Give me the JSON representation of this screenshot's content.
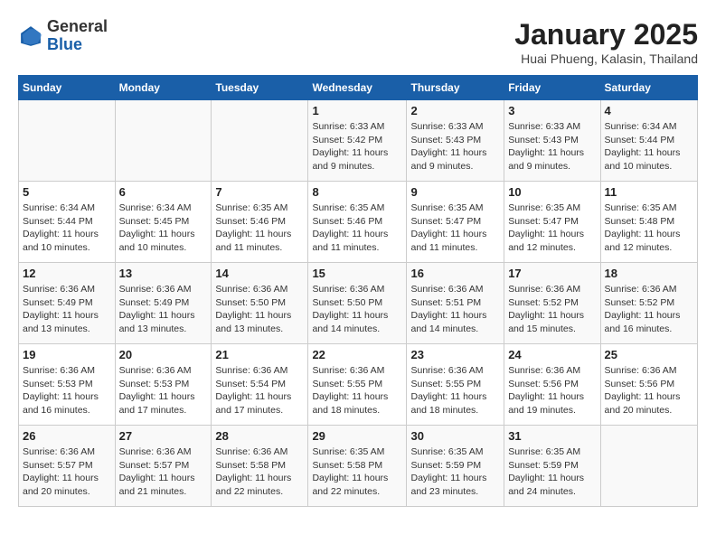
{
  "header": {
    "logo_general": "General",
    "logo_blue": "Blue",
    "month_year": "January 2025",
    "location": "Huai Phueng, Kalasin, Thailand"
  },
  "weekdays": [
    "Sunday",
    "Monday",
    "Tuesday",
    "Wednesday",
    "Thursday",
    "Friday",
    "Saturday"
  ],
  "weeks": [
    [
      {
        "day": "",
        "info": ""
      },
      {
        "day": "",
        "info": ""
      },
      {
        "day": "",
        "info": ""
      },
      {
        "day": "1",
        "info": "Sunrise: 6:33 AM\nSunset: 5:42 PM\nDaylight: 11 hours\nand 9 minutes."
      },
      {
        "day": "2",
        "info": "Sunrise: 6:33 AM\nSunset: 5:43 PM\nDaylight: 11 hours\nand 9 minutes."
      },
      {
        "day": "3",
        "info": "Sunrise: 6:33 AM\nSunset: 5:43 PM\nDaylight: 11 hours\nand 9 minutes."
      },
      {
        "day": "4",
        "info": "Sunrise: 6:34 AM\nSunset: 5:44 PM\nDaylight: 11 hours\nand 10 minutes."
      }
    ],
    [
      {
        "day": "5",
        "info": "Sunrise: 6:34 AM\nSunset: 5:44 PM\nDaylight: 11 hours\nand 10 minutes."
      },
      {
        "day": "6",
        "info": "Sunrise: 6:34 AM\nSunset: 5:45 PM\nDaylight: 11 hours\nand 10 minutes."
      },
      {
        "day": "7",
        "info": "Sunrise: 6:35 AM\nSunset: 5:46 PM\nDaylight: 11 hours\nand 11 minutes."
      },
      {
        "day": "8",
        "info": "Sunrise: 6:35 AM\nSunset: 5:46 PM\nDaylight: 11 hours\nand 11 minutes."
      },
      {
        "day": "9",
        "info": "Sunrise: 6:35 AM\nSunset: 5:47 PM\nDaylight: 11 hours\nand 11 minutes."
      },
      {
        "day": "10",
        "info": "Sunrise: 6:35 AM\nSunset: 5:47 PM\nDaylight: 11 hours\nand 12 minutes."
      },
      {
        "day": "11",
        "info": "Sunrise: 6:35 AM\nSunset: 5:48 PM\nDaylight: 11 hours\nand 12 minutes."
      }
    ],
    [
      {
        "day": "12",
        "info": "Sunrise: 6:36 AM\nSunset: 5:49 PM\nDaylight: 11 hours\nand 13 minutes."
      },
      {
        "day": "13",
        "info": "Sunrise: 6:36 AM\nSunset: 5:49 PM\nDaylight: 11 hours\nand 13 minutes."
      },
      {
        "day": "14",
        "info": "Sunrise: 6:36 AM\nSunset: 5:50 PM\nDaylight: 11 hours\nand 13 minutes."
      },
      {
        "day": "15",
        "info": "Sunrise: 6:36 AM\nSunset: 5:50 PM\nDaylight: 11 hours\nand 14 minutes."
      },
      {
        "day": "16",
        "info": "Sunrise: 6:36 AM\nSunset: 5:51 PM\nDaylight: 11 hours\nand 14 minutes."
      },
      {
        "day": "17",
        "info": "Sunrise: 6:36 AM\nSunset: 5:52 PM\nDaylight: 11 hours\nand 15 minutes."
      },
      {
        "day": "18",
        "info": "Sunrise: 6:36 AM\nSunset: 5:52 PM\nDaylight: 11 hours\nand 16 minutes."
      }
    ],
    [
      {
        "day": "19",
        "info": "Sunrise: 6:36 AM\nSunset: 5:53 PM\nDaylight: 11 hours\nand 16 minutes."
      },
      {
        "day": "20",
        "info": "Sunrise: 6:36 AM\nSunset: 5:53 PM\nDaylight: 11 hours\nand 17 minutes."
      },
      {
        "day": "21",
        "info": "Sunrise: 6:36 AM\nSunset: 5:54 PM\nDaylight: 11 hours\nand 17 minutes."
      },
      {
        "day": "22",
        "info": "Sunrise: 6:36 AM\nSunset: 5:55 PM\nDaylight: 11 hours\nand 18 minutes."
      },
      {
        "day": "23",
        "info": "Sunrise: 6:36 AM\nSunset: 5:55 PM\nDaylight: 11 hours\nand 18 minutes."
      },
      {
        "day": "24",
        "info": "Sunrise: 6:36 AM\nSunset: 5:56 PM\nDaylight: 11 hours\nand 19 minutes."
      },
      {
        "day": "25",
        "info": "Sunrise: 6:36 AM\nSunset: 5:56 PM\nDaylight: 11 hours\nand 20 minutes."
      }
    ],
    [
      {
        "day": "26",
        "info": "Sunrise: 6:36 AM\nSunset: 5:57 PM\nDaylight: 11 hours\nand 20 minutes."
      },
      {
        "day": "27",
        "info": "Sunrise: 6:36 AM\nSunset: 5:57 PM\nDaylight: 11 hours\nand 21 minutes."
      },
      {
        "day": "28",
        "info": "Sunrise: 6:36 AM\nSunset: 5:58 PM\nDaylight: 11 hours\nand 22 minutes."
      },
      {
        "day": "29",
        "info": "Sunrise: 6:35 AM\nSunset: 5:58 PM\nDaylight: 11 hours\nand 22 minutes."
      },
      {
        "day": "30",
        "info": "Sunrise: 6:35 AM\nSunset: 5:59 PM\nDaylight: 11 hours\nand 23 minutes."
      },
      {
        "day": "31",
        "info": "Sunrise: 6:35 AM\nSunset: 5:59 PM\nDaylight: 11 hours\nand 24 minutes."
      },
      {
        "day": "",
        "info": ""
      }
    ]
  ]
}
